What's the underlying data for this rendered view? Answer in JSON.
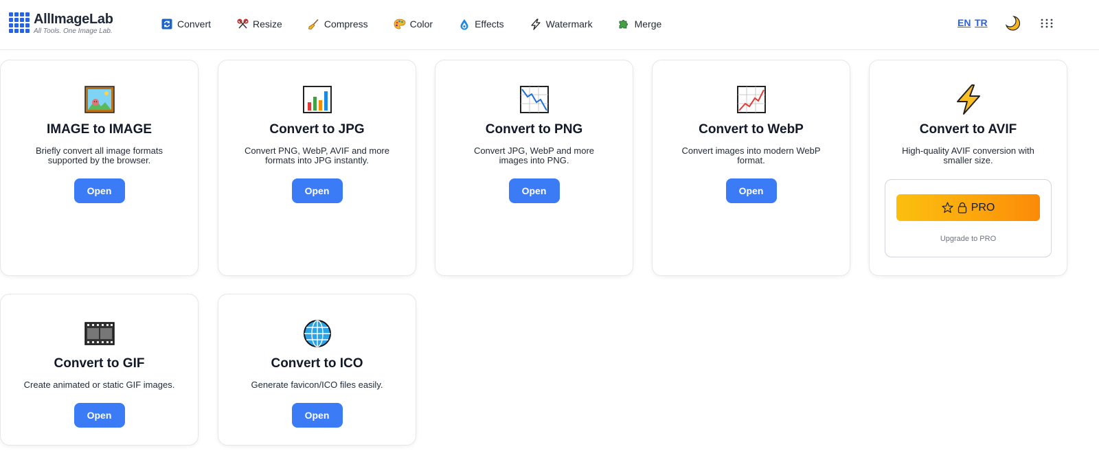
{
  "header": {
    "brand": "AllImageLab",
    "tagline": "All Tools. One Image Lab.",
    "nav": [
      {
        "label": "Convert",
        "icon": "convert-icon"
      },
      {
        "label": "Resize",
        "icon": "scissors-icon"
      },
      {
        "label": "Compress",
        "icon": "broom-icon"
      },
      {
        "label": "Color",
        "icon": "palette-icon"
      },
      {
        "label": "Effects",
        "icon": "drop-icon"
      },
      {
        "label": "Watermark",
        "icon": "lightning-icon"
      },
      {
        "label": "Merge",
        "icon": "puzzle-icon"
      }
    ],
    "lang_en": "EN",
    "lang_tr": "TR",
    "theme_icon": "moon-icon",
    "apps_icon": "apps-grid-icon"
  },
  "cards": [
    {
      "title": "IMAGE to IMAGE",
      "desc": "Briefly convert all image formats supported by the browser.",
      "button": "Open",
      "icon": "framed-picture-icon"
    },
    {
      "title": "Convert to JPG",
      "desc": "Convert PNG, WebP, AVIF and more formats into JPG instantly.",
      "button": "Open",
      "icon": "bar-chart-icon"
    },
    {
      "title": "Convert to PNG",
      "desc": "Convert JPG, WebP and more images into PNG.",
      "button": "Open",
      "icon": "chart-decreasing-icon"
    },
    {
      "title": "Convert to WebP",
      "desc": "Convert images into modern WebP format.",
      "button": "Open",
      "icon": "chart-increasing-icon"
    },
    {
      "title": "Convert to AVIF",
      "desc": "High-quality AVIF conversion with smaller size.",
      "pro_label": "PRO",
      "pro_note": "Upgrade to PRO",
      "icon": "high-voltage-icon"
    },
    {
      "title": "Convert to GIF",
      "desc": "Create animated or static GIF images.",
      "button": "Open",
      "icon": "film-frames-icon"
    },
    {
      "title": "Convert to ICO",
      "desc": "Generate favicon/ICO files easily.",
      "button": "Open",
      "icon": "globe-icon"
    }
  ],
  "colors": {
    "accent": "#3b7cf6",
    "link": "#2563eb",
    "pro_gradient_start": "#fbbf0f",
    "pro_gradient_end": "#fb8a08"
  }
}
